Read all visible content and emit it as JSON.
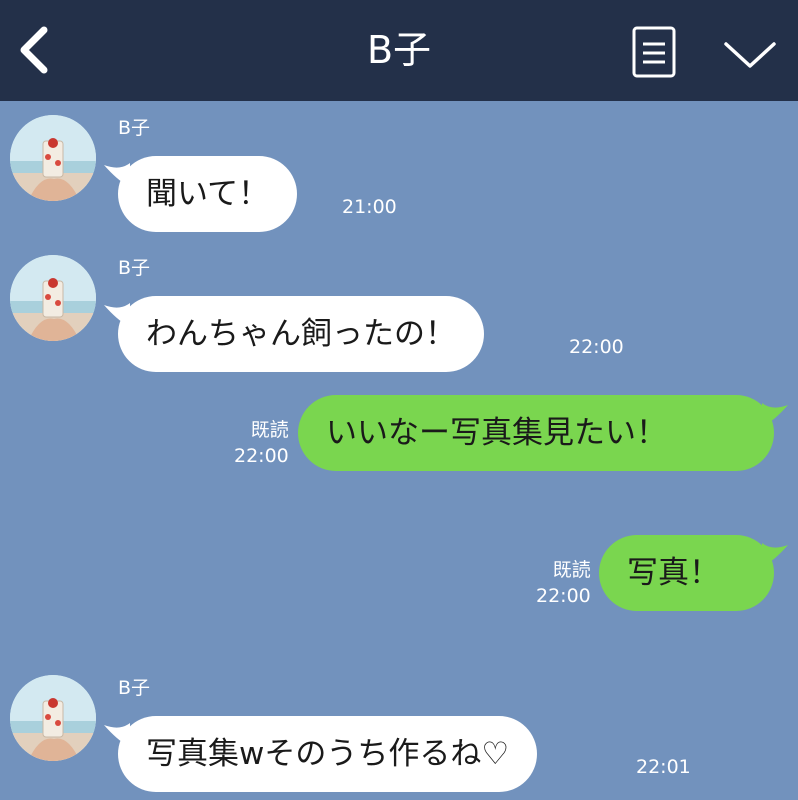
{
  "header": {
    "title": "B子"
  },
  "messages": [
    {
      "sender": "B子",
      "text": "聞いて！",
      "time": "21:00"
    },
    {
      "sender": "B子",
      "text": "わんちゃん飼ったの！",
      "time": "22:00"
    },
    {
      "text": "いいなー写真集見たい！",
      "read": "既読",
      "time": "22:00"
    },
    {
      "text": "写真！",
      "read": "既読",
      "time": "22:00"
    },
    {
      "sender": "B子",
      "text": "写真集wそのうち作るね♡",
      "time": "22:01"
    }
  ],
  "colors": {
    "header_bg": "#233049",
    "chat_bg": "#7292bd",
    "incoming_bubble": "#ffffff",
    "outgoing_bubble": "#7ad64f"
  },
  "icons": {
    "back": "chevron-left-icon",
    "menu": "list-icon",
    "expand": "chevron-down-icon"
  }
}
